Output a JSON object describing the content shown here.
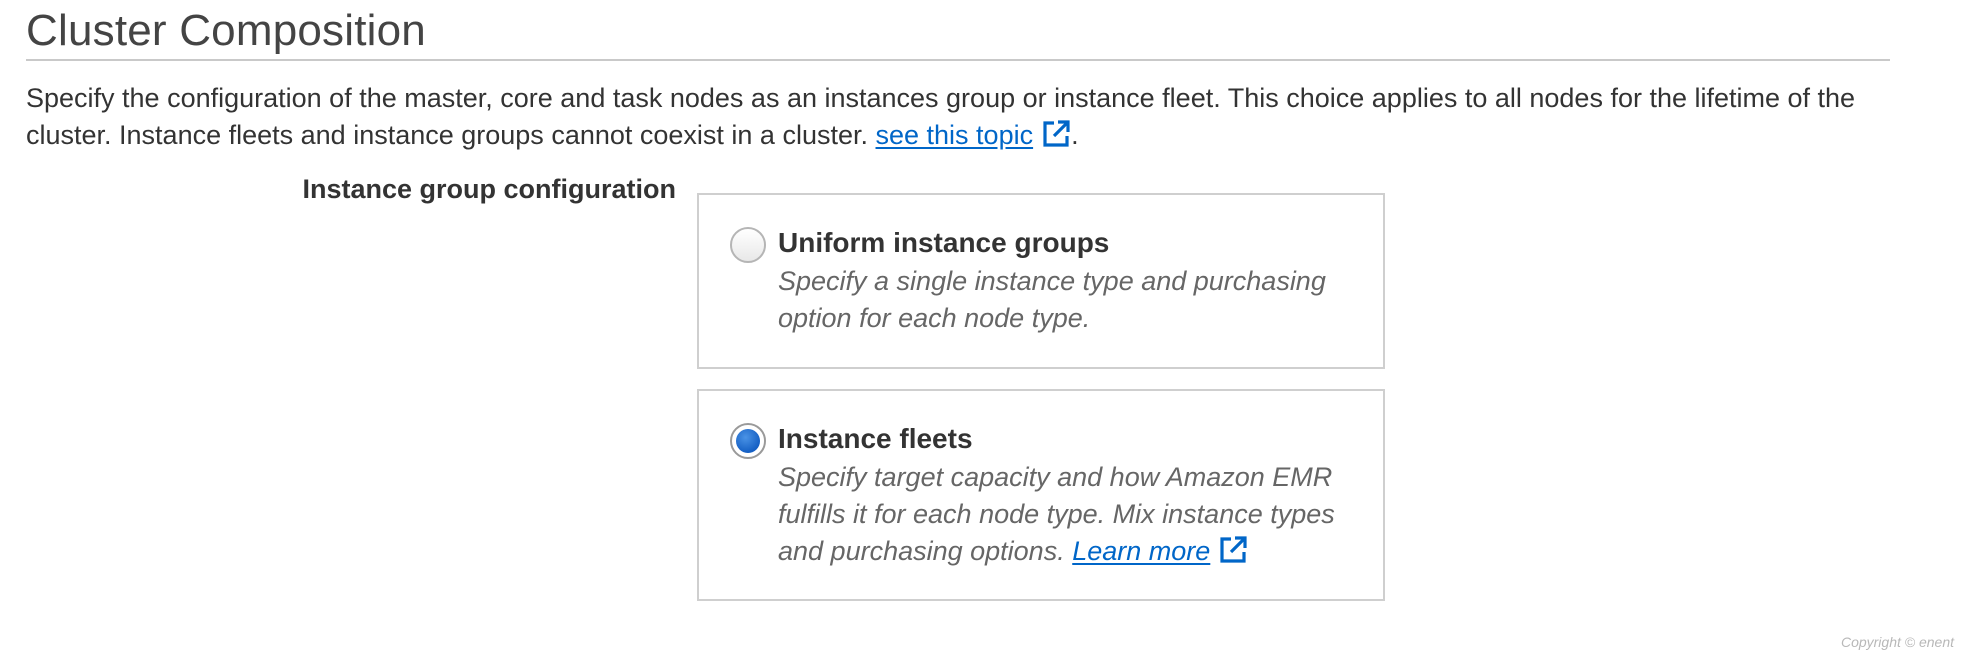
{
  "page": {
    "title": "Cluster Composition",
    "description_text": "Specify the configuration of the master, core and task nodes as an instances group or instance fleet. This choice applies to all nodes for the lifetime of the cluster. Instance fleets and instance groups cannot coexist in a cluster.",
    "description_link": "see this topic",
    "description_end": "."
  },
  "instance_group_configuration": {
    "label": "Instance group configuration",
    "selected": "Instance fleets",
    "options": [
      {
        "title": "Uniform instance groups",
        "description": "Specify a single instance type and purchasing option for each node type.",
        "checked": false
      },
      {
        "title": "Instance fleets",
        "description": "Specify target capacity and how Amazon EMR fulfills it for each node type. Mix instance types and purchasing options.",
        "link": "Learn more",
        "checked": true
      }
    ]
  },
  "footer": {
    "copyright": "Copyright © enent"
  },
  "colors": {
    "link": "#0066c8",
    "radio_selected": "#1560c4",
    "card_border": "#cfcfcf",
    "title_rule": "#c9c9c9"
  },
  "icons": {
    "external_link": "external-link-icon"
  }
}
